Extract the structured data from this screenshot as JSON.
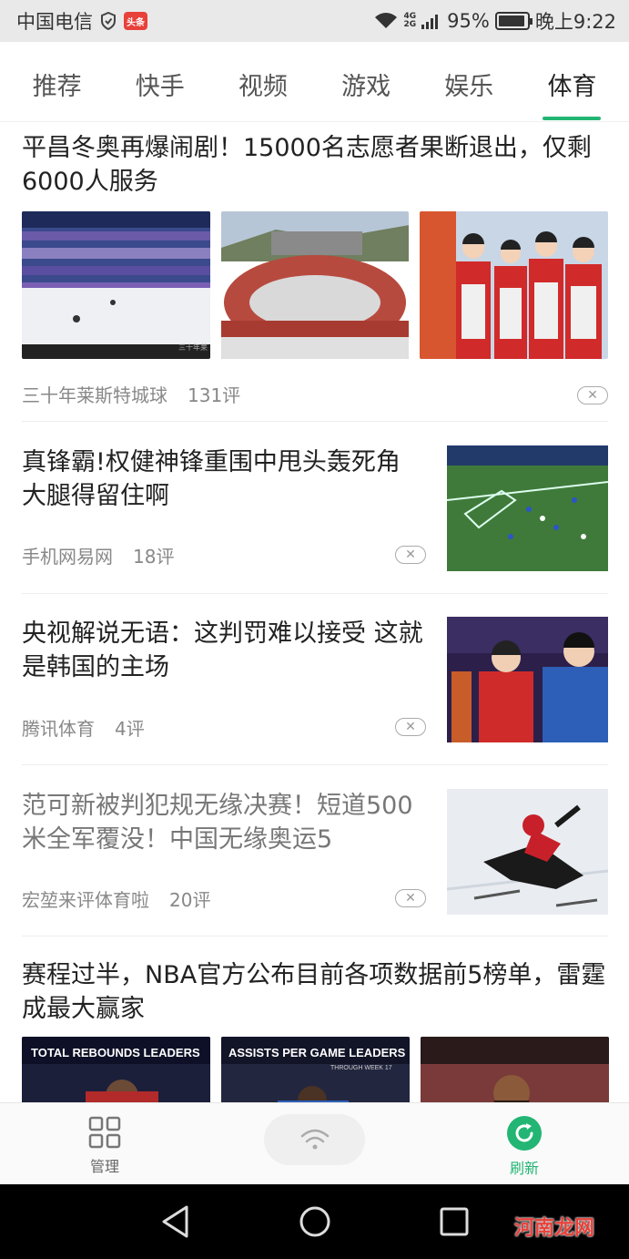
{
  "status_bar": {
    "carrier": "中国电信",
    "app_badge": "头条",
    "network": "4G",
    "network2": "2G",
    "battery": "95%",
    "time": "晚上9:22"
  },
  "tabs": [
    {
      "label": "推荐"
    },
    {
      "label": "快手"
    },
    {
      "label": "视频"
    },
    {
      "label": "游戏"
    },
    {
      "label": "娱乐"
    },
    {
      "label": "体育",
      "active": true
    }
  ],
  "articles": [
    {
      "title": "平昌冬奥再爆闹剧！15000名志愿者果断退出，仅剩6000人服务",
      "source": "三十年莱斯特城球",
      "comments": "131评",
      "image_labels": [
        "三十年莱"
      ]
    },
    {
      "title": "真锋霸!权健神锋重围中甩头轰死角 大腿得留住啊",
      "source": "手机网易网",
      "comments": "18评"
    },
    {
      "title": "央视解说无语：这判罚难以接受 这就是韩国的主场",
      "source": "腾讯体育",
      "comments": "4评"
    },
    {
      "title": "范可新被判犯规无缘决赛！短道500米全军覆没！中国无缘奥运5",
      "source": "宏堃来评体育啦",
      "comments": "20评"
    },
    {
      "title": "赛程过半，NBA官方公布目前各项数据前5榜单，雷霆成最大赢家",
      "image_labels": [
        "TOTAL REBOUNDS LEADERS",
        "ASSISTS PER GAME LEADERS",
        "THROUGH WEEK 17"
      ]
    }
  ],
  "bottom_bar": {
    "manage_label": "管理",
    "refresh_label": "刷新"
  },
  "watermark": "河南龙网",
  "colors": {
    "accent": "#22b573",
    "status_bar_bg": "#e9e9e9"
  }
}
